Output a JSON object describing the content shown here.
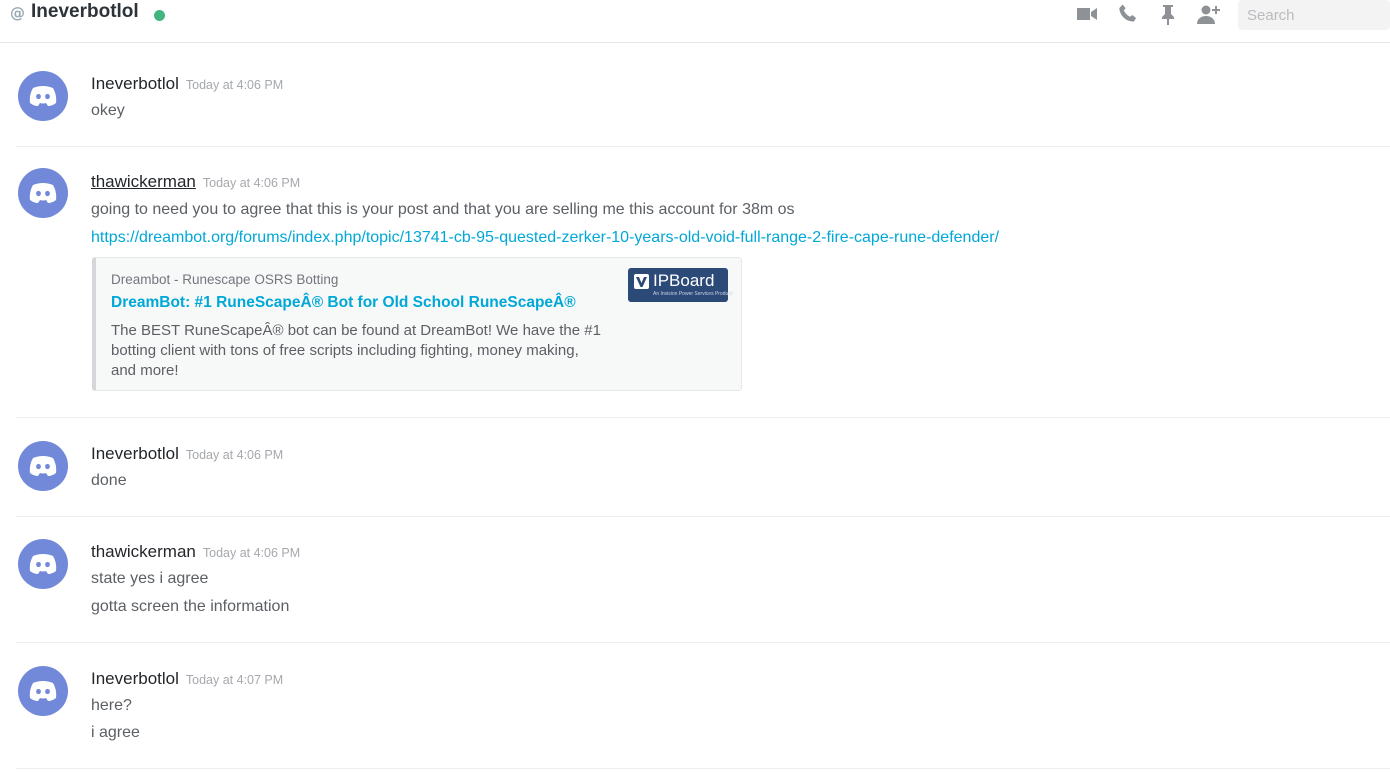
{
  "header": {
    "at_symbol": "@",
    "title": "Ineverbotlol",
    "status": "online",
    "status_color": "#43b581",
    "icons": [
      "video-camera-icon",
      "phone-call-icon",
      "pin-icon",
      "add-user-icon"
    ],
    "search_placeholder": "Search"
  },
  "messages": [
    {
      "author": "Ineverbotlol",
      "timestamp": "Today at 4:06 PM",
      "lines": [
        "okey"
      ]
    },
    {
      "author": "thawickerman",
      "timestamp": "Today at 4:06 PM",
      "lines": [
        "going to need you to agree that this is your post and that you are selling me this account for 38m os"
      ],
      "link": "https://dreambot.org/forums/index.php/topic/13741-cb-95-quested-zerker-10-years-old-void-full-range-2-fire-cape-rune-defender/",
      "embed": {
        "provider": "Dreambot - Runescape OSRS Botting",
        "title": "DreamBot: #1 RuneScapeÂ® Bot for Old School RuneScapeÂ®",
        "description": "The BEST RuneScapeÂ® bot can be found at DreamBot! We have the #1 botting client with tons of free scripts including fighting, money making, and more!",
        "thumbnail_text": "IPBoard",
        "thumbnail_subtext": "An Invision Power Services Product"
      }
    },
    {
      "author": "Ineverbotlol",
      "timestamp": "Today at 4:06 PM",
      "lines": [
        "done"
      ]
    },
    {
      "author": "thawickerman",
      "timestamp": "Today at 4:06 PM",
      "lines": [
        "state yes i agree",
        "gotta screen the information"
      ]
    },
    {
      "author": "Ineverbotlol",
      "timestamp": "Today at 4:07 PM",
      "lines": [
        "here?",
        "i agree"
      ]
    }
  ],
  "colors": {
    "avatar": "#7289da",
    "link": "#00a8d8",
    "embed_thumbnail": "#2c4a78"
  }
}
